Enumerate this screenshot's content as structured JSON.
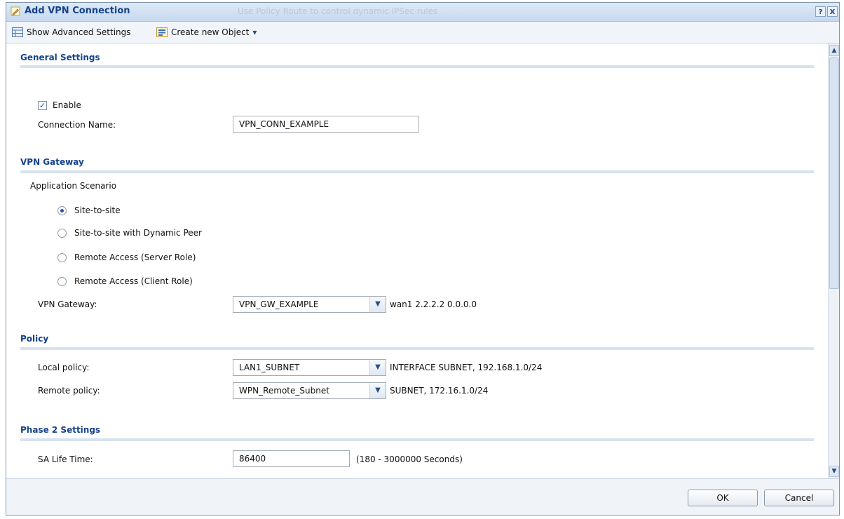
{
  "window": {
    "title": "Add VPN Connection",
    "background_hint": "Use Policy Route to control dynamic IPSec rules",
    "help_label": "?",
    "close_label": "X"
  },
  "toolbar": {
    "advanced_label": "Show Advanced Settings",
    "create_label": "Create new Object",
    "create_arrow": "▾"
  },
  "general": {
    "title": "General Settings",
    "enable_label": "Enable",
    "enable_checked": true,
    "conn_name_label": "Connection Name:",
    "conn_name_value": "VPN_CONN_EXAMPLE"
  },
  "gateway": {
    "title": "VPN Gateway",
    "scenario_label": "Application Scenario",
    "scenarios": [
      {
        "label": "Site-to-site",
        "selected": true
      },
      {
        "label": "Site-to-site with Dynamic Peer",
        "selected": false
      },
      {
        "label": "Remote Access (Server Role)",
        "selected": false
      },
      {
        "label": "Remote Access (Client Role)",
        "selected": false
      }
    ],
    "gw_label": "VPN Gateway:",
    "gw_value": "VPN_GW_EXAMPLE",
    "gw_info": "wan1 2.2.2.2 0.0.0.0"
  },
  "policy": {
    "title": "Policy",
    "local_label": "Local policy:",
    "local_value": "LAN1_SUBNET",
    "local_info": "INTERFACE SUBNET, 192.168.1.0/24",
    "remote_label": "Remote policy:",
    "remote_value": "WPN_Remote_Subnet",
    "remote_info": "SUBNET, 172.16.1.0/24"
  },
  "phase2": {
    "title": "Phase 2 Settings",
    "sa_label": "SA Life Time:",
    "sa_value": "86400",
    "sa_range": "(180 - 3000000 Seconds)"
  },
  "footer": {
    "ok_label": "OK",
    "cancel_label": "Cancel"
  },
  "colors": {
    "accent": "#15428b",
    "section_line": "#d6e2ef",
    "radio_dot": "#2b4fb0"
  },
  "icons": {
    "title": "pencil-icon",
    "advanced": "table-icon",
    "create": "object-icon",
    "dropdown": "chevron-down-icon"
  }
}
